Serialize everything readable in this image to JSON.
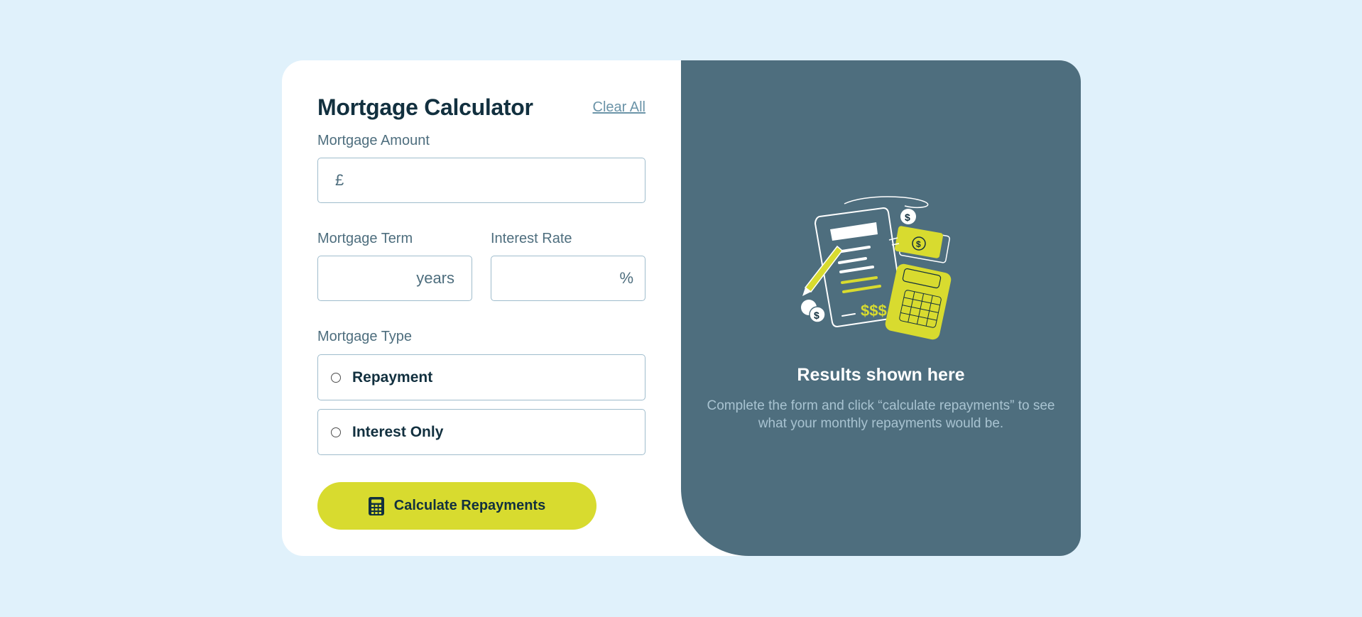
{
  "calculator": {
    "title": "Mortgage Calculator",
    "clear_label": "Clear All",
    "amount": {
      "label": "Mortgage Amount",
      "prefix": "£",
      "value": ""
    },
    "term": {
      "label": "Mortgage Term",
      "suffix": "years",
      "value": ""
    },
    "rate": {
      "label": "Interest Rate",
      "suffix": "%",
      "value": ""
    },
    "type": {
      "label": "Mortgage Type",
      "options": [
        {
          "label": "Repayment",
          "selected": false
        },
        {
          "label": "Interest Only",
          "selected": false
        }
      ]
    },
    "submit_label": "Calculate Repayments",
    "submit_icon": "calculator-icon"
  },
  "results": {
    "title": "Results shown here",
    "description": "Complete the form and click “calculate repayments” to see what your monthly repayments would be.",
    "illustration": "empty-results-illustration"
  },
  "colors": {
    "page_background": "#e0f1fb",
    "accent": "#d8db2f",
    "results_background": "#4e6e7e",
    "heading": "#12303f",
    "border": "#9fbccc"
  }
}
